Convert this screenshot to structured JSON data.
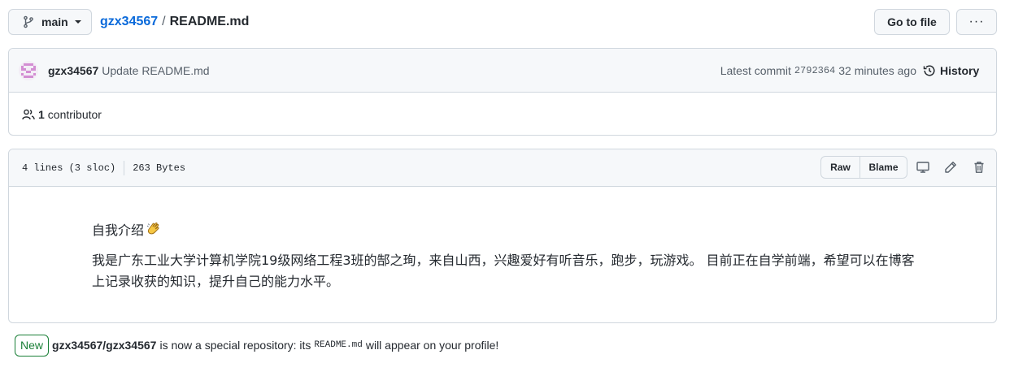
{
  "branch": {
    "name": "main",
    "icon": "git-branch-icon"
  },
  "breadcrumb": {
    "repo": "gzx34567",
    "separator": "/",
    "file": "README.md"
  },
  "toolbar": {
    "goto_file": "Go to file",
    "more": "···"
  },
  "commit": {
    "author": "gzx34567",
    "message": "Update README.md",
    "latest_label": "Latest commit",
    "sha": "2792364",
    "time": "32 minutes ago",
    "history_label": "History"
  },
  "contributors": {
    "count": "1",
    "label": "contributor"
  },
  "file": {
    "lines": "4 lines (3 sloc)",
    "size": "263 Bytes",
    "raw_label": "Raw",
    "blame_label": "Blame"
  },
  "readme": {
    "title": "自我介绍",
    "title_emoji": "clapping-hands-icon",
    "paragraph": "我是广东工业大学计算机学院19级网络工程3班的郜之珣，来自山西，兴趣爱好有听音乐，跑步，玩游戏。 目前正在自学前端，希望可以在博客上记录收获的知识，提升自己的能力水平。"
  },
  "notice": {
    "badge": "New",
    "repo_full": "gzx34567/gzx34567",
    "text_before": "is now a special repository: its",
    "code": "README.md",
    "text_after": "will appear on your profile!"
  },
  "colors": {
    "link": "#0969da",
    "border": "#d0d7de",
    "header_bg": "#f6f8fa",
    "muted": "#57606a",
    "success": "#1a7f37"
  }
}
